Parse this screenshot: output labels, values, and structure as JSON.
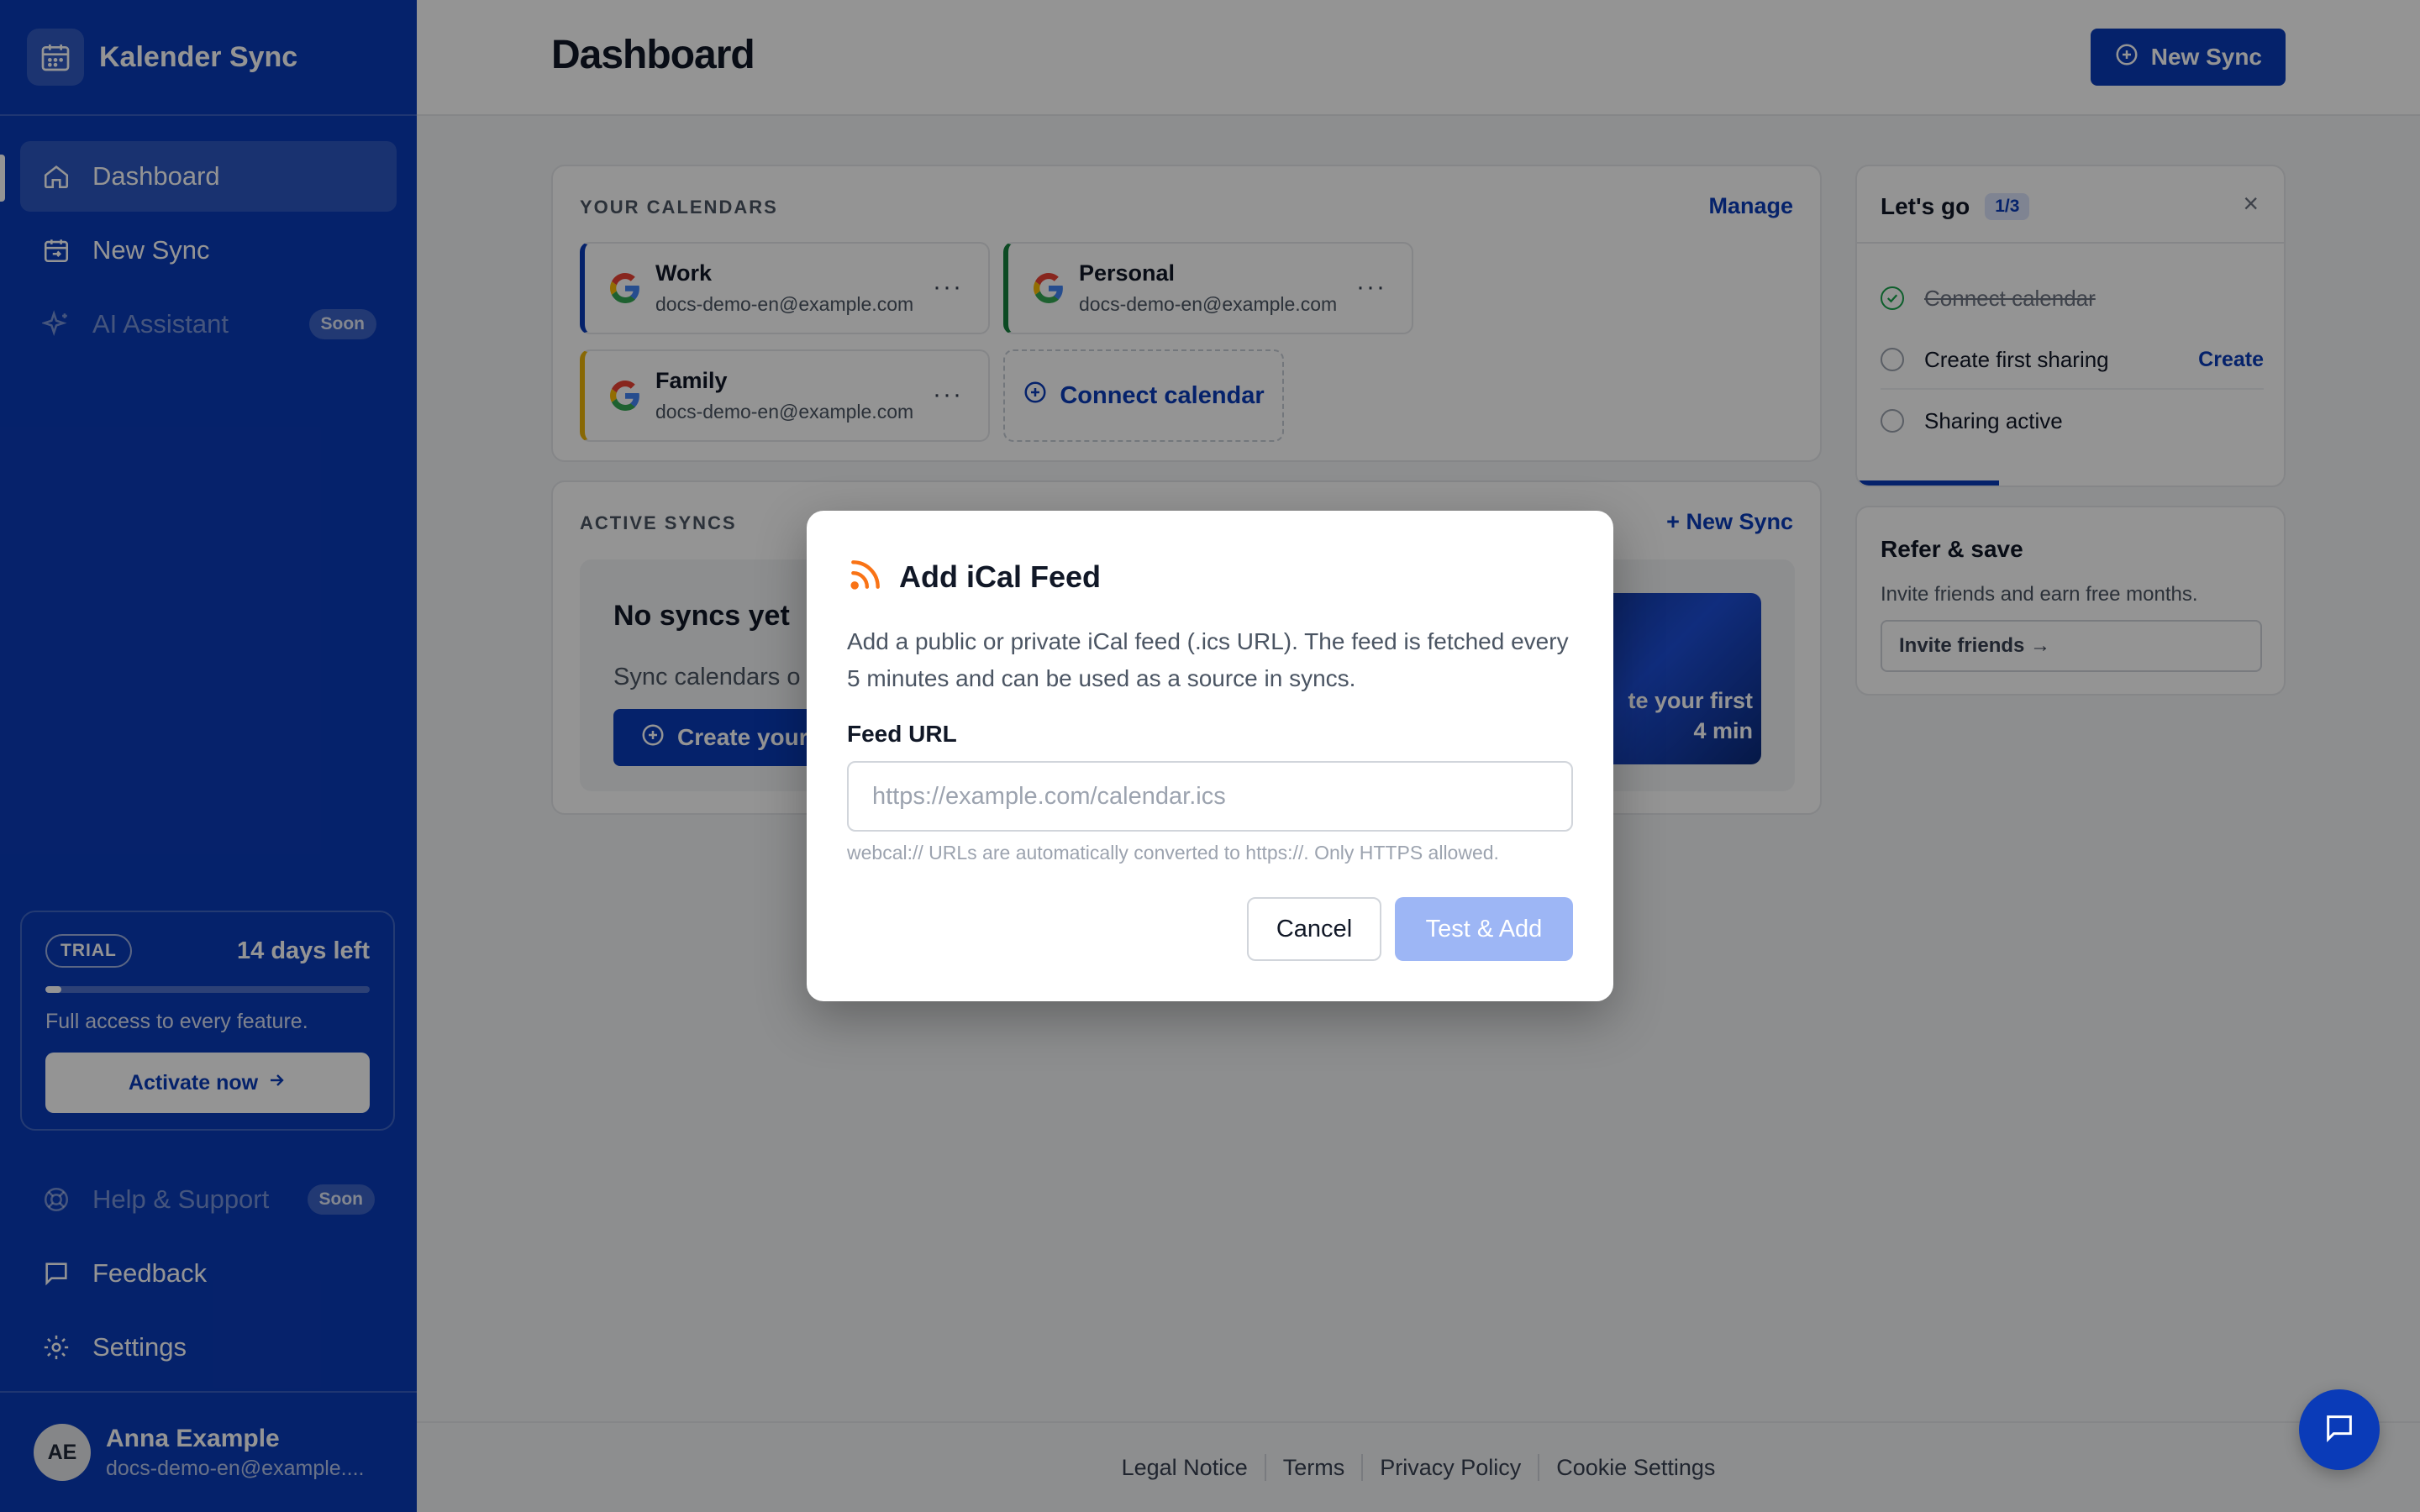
{
  "app": {
    "name": "Kalender Sync"
  },
  "sidebar": {
    "nav": [
      {
        "label": "Dashboard",
        "icon": "home-icon",
        "active": true
      },
      {
        "label": "New Sync",
        "icon": "calendar-sync-icon"
      },
      {
        "label": "AI Assistant",
        "icon": "sparkles-icon",
        "badge": "Soon",
        "disabled": true
      }
    ],
    "trial": {
      "pill": "TRIAL",
      "days_left": "14 days left",
      "progress": 0.05,
      "description": "Full access to every feature.",
      "button": "Activate now"
    },
    "bottom_nav": [
      {
        "label": "Help & Support",
        "icon": "lifebuoy-icon",
        "badge": "Soon",
        "disabled": true
      },
      {
        "label": "Feedback",
        "icon": "message-icon"
      },
      {
        "label": "Settings",
        "icon": "gear-icon"
      }
    ],
    "user": {
      "initials": "AE",
      "name": "Anna Example",
      "email": "docs-demo-en@example...."
    }
  },
  "header": {
    "title": "Dashboard",
    "new_sync": "New Sync"
  },
  "calendars": {
    "section_label": "YOUR CALENDARS",
    "manage": "Manage",
    "items": [
      {
        "name": "Work",
        "email": "docs-demo-en@example.com",
        "color": "#0a3bb8",
        "menu": "···"
      },
      {
        "name": "Personal",
        "email": "docs-demo-en@example.com",
        "color": "#15803d",
        "menu": "···"
      },
      {
        "name": "Family",
        "email": "docs-demo-en@example.com",
        "color": "#eab308",
        "menu": "···"
      }
    ],
    "connect": "Connect calendar"
  },
  "syncs": {
    "section_label": "ACTIVE SYNCS",
    "new_sync": "+ New Sync",
    "empty_title": "No syncs yet",
    "empty_desc": "Sync calendars o",
    "create_button": "Create your f",
    "video_line1": "te your first",
    "video_line2": "4 min"
  },
  "onboarding": {
    "title": "Let's go",
    "count": "1/3",
    "close": "×",
    "progress": 0.333,
    "steps": [
      {
        "label": "Connect calendar",
        "done": true
      },
      {
        "label": "Create first sharing",
        "action": "Create"
      },
      {
        "label": "Sharing active"
      }
    ]
  },
  "refer": {
    "title": "Refer & save",
    "description": "Invite friends and earn free months.",
    "button": "Invite friends →"
  },
  "footer": {
    "links": [
      "Legal Notice",
      "Terms",
      "Privacy Policy",
      "Cookie Settings"
    ]
  },
  "modal": {
    "title": "Add iCal Feed",
    "icon": "rss-icon",
    "description": "Add a public or private iCal feed (.ics URL). The feed is fetched every 5 minutes and can be used as a source in syncs.",
    "field_label": "Feed URL",
    "placeholder": "https://example.com/calendar.ics",
    "value": "",
    "hint": "webcal:// URLs are automatically converted to https://. Only HTTPS allowed.",
    "cancel": "Cancel",
    "submit": "Test & Add"
  },
  "colors": {
    "primary": "#0a3bb8",
    "rss": "#f97316",
    "submit_disabled": "#9db6f5"
  }
}
